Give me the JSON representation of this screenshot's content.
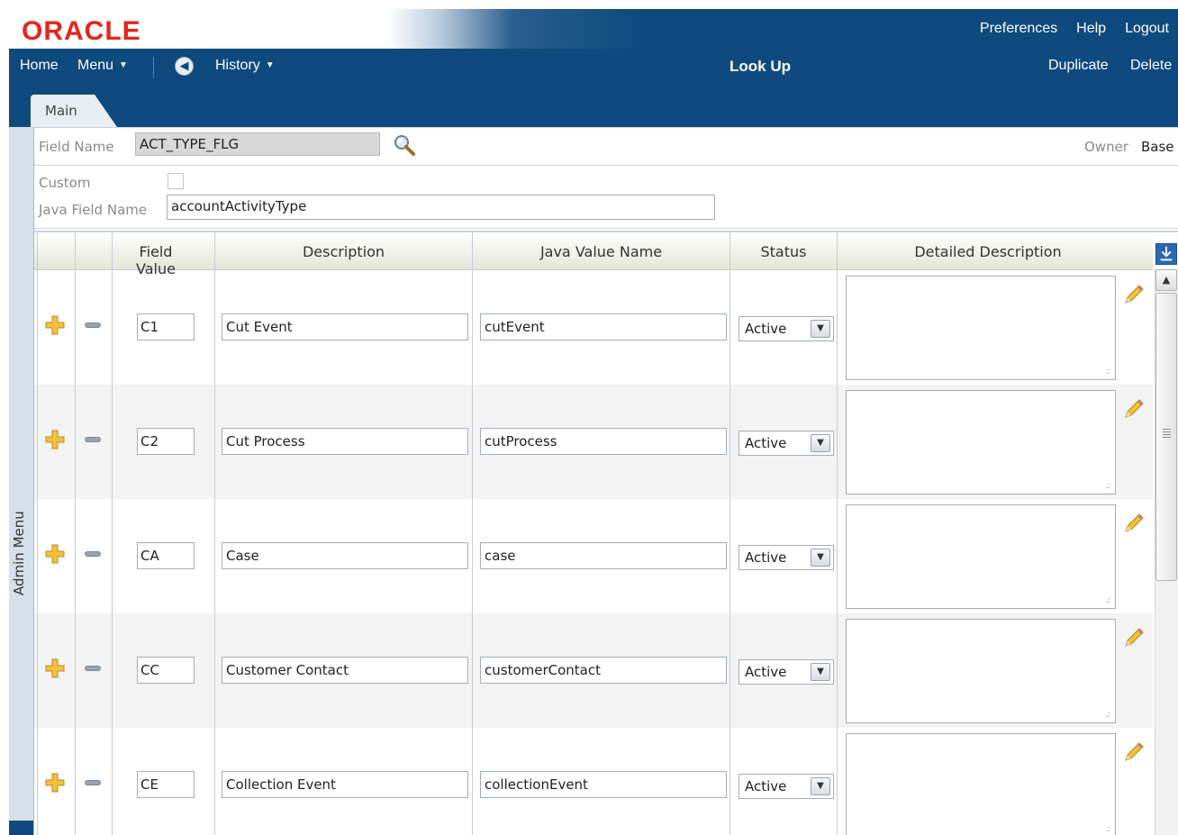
{
  "header": {
    "logo": "ORACLE",
    "links": [
      "Preferences",
      "Help",
      "Logout"
    ]
  },
  "nav": {
    "home": "Home",
    "menu": "Menu",
    "history": "History",
    "page_title": "Look Up",
    "duplicate": "Duplicate",
    "delete": "Delete"
  },
  "tabs": {
    "main": "Main"
  },
  "sidebar": {
    "label": "Admin Menu"
  },
  "form": {
    "field_name_label": "Field Name",
    "field_name_value": "ACT_TYPE_FLG",
    "owner_label": "Owner",
    "owner_value": "Base",
    "custom_label": "Custom",
    "custom_checked": false,
    "java_field_name_label": "Java Field Name",
    "java_field_name_value": "accountActivityType"
  },
  "grid": {
    "columns": [
      "Field Value",
      "Description",
      "Java Value Name",
      "Status",
      "Detailed Description"
    ],
    "rows": [
      {
        "field_value": "C1",
        "description": "Cut Event",
        "java_value_name": "cutEvent",
        "status": "Active",
        "detailed_description": ""
      },
      {
        "field_value": "C2",
        "description": "Cut Process",
        "java_value_name": "cutProcess",
        "status": "Active",
        "detailed_description": ""
      },
      {
        "field_value": "CA",
        "description": "Case",
        "java_value_name": "case",
        "status": "Active",
        "detailed_description": ""
      },
      {
        "field_value": "CC",
        "description": "Customer Contact",
        "java_value_name": "customerContact",
        "status": "Active",
        "detailed_description": ""
      },
      {
        "field_value": "CE",
        "description": "Collection Event",
        "java_value_name": "collectionEvent",
        "status": "Active",
        "detailed_description": ""
      }
    ]
  },
  "colors": {
    "brand_red": "#e2271a",
    "nav_blue": "#0e4a7e"
  }
}
